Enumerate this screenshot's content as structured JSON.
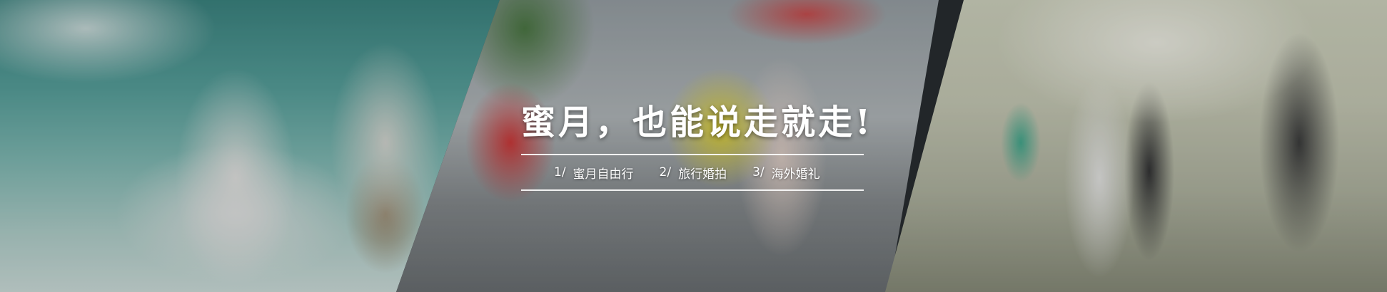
{
  "banner": {
    "headline": "蜜月，也能说走就走!",
    "menu": [
      {
        "num": "1/",
        "label": "蜜月自由行"
      },
      {
        "num": "2/",
        "label": "旅行婚拍"
      },
      {
        "num": "3/",
        "label": "海外婚礼"
      }
    ]
  },
  "colors": {
    "text": "#ffffff",
    "rule": "#ffffff"
  }
}
